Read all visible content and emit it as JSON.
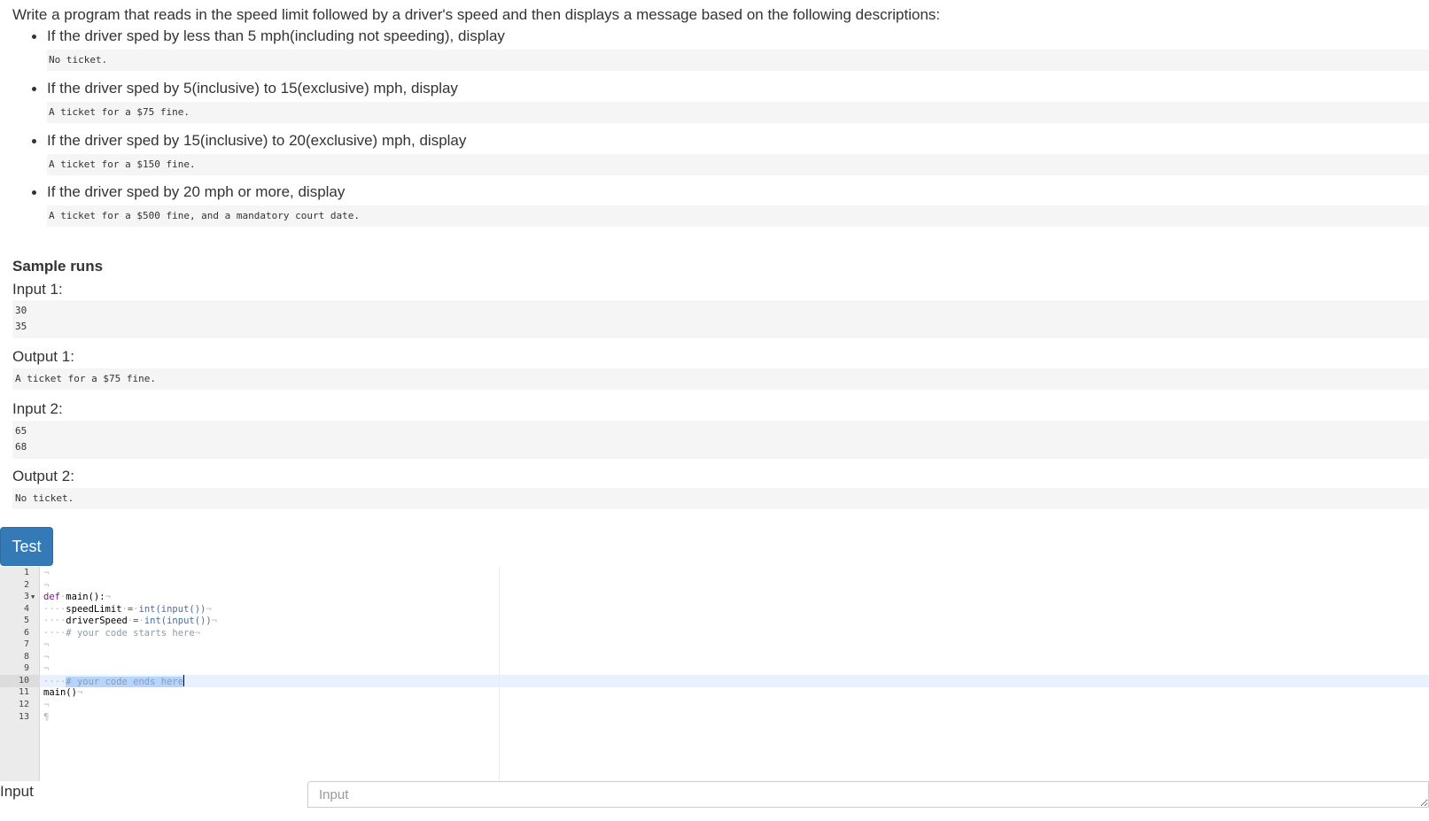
{
  "problem": {
    "intro": "Write a program that reads in the speed limit followed by a driver's speed and then displays a message based on the following descriptions:",
    "rules": [
      {
        "text": "If the driver sped by less than 5 mph(including not speeding), display",
        "output": "No ticket."
      },
      {
        "text": "If the driver sped by 5(inclusive) to 15(exclusive) mph, display",
        "output": "A ticket for a $75 fine."
      },
      {
        "text": "If the driver sped by 15(inclusive) to 20(exclusive) mph, display",
        "output": "A ticket for a $150 fine."
      },
      {
        "text": "If the driver sped by 20 mph or more, display",
        "output": "A ticket for a $500 fine, and a mandatory court date."
      }
    ]
  },
  "samples": {
    "heading": "Sample runs",
    "input1_label": "Input 1:",
    "input1": "30\n35",
    "output1_label": "Output 1:",
    "output1": "A ticket for a $75 fine.",
    "input2_label": "Input 2:",
    "input2": "65\n68",
    "output2_label": "Output 2:",
    "output2": "No ticket."
  },
  "test_button": "Test",
  "editor": {
    "line_numbers": [
      "1",
      "2",
      "3",
      "4",
      "5",
      "6",
      "7",
      "8",
      "9",
      "10",
      "11",
      "12",
      "13"
    ],
    "code": {
      "def_kw": "def",
      "main_sig": "main():",
      "speed_limit_var": "speedLimit",
      "speed_limit_expr": "int(input())",
      "driver_speed_var": "driverSpeed",
      "driver_speed_expr": "int(input())",
      "comment_start": "# your code starts here",
      "comment_end": "# your code ends here",
      "main_call": "main()"
    },
    "active_line": 10
  },
  "input_area": {
    "label": "Input",
    "placeholder": "Input"
  }
}
